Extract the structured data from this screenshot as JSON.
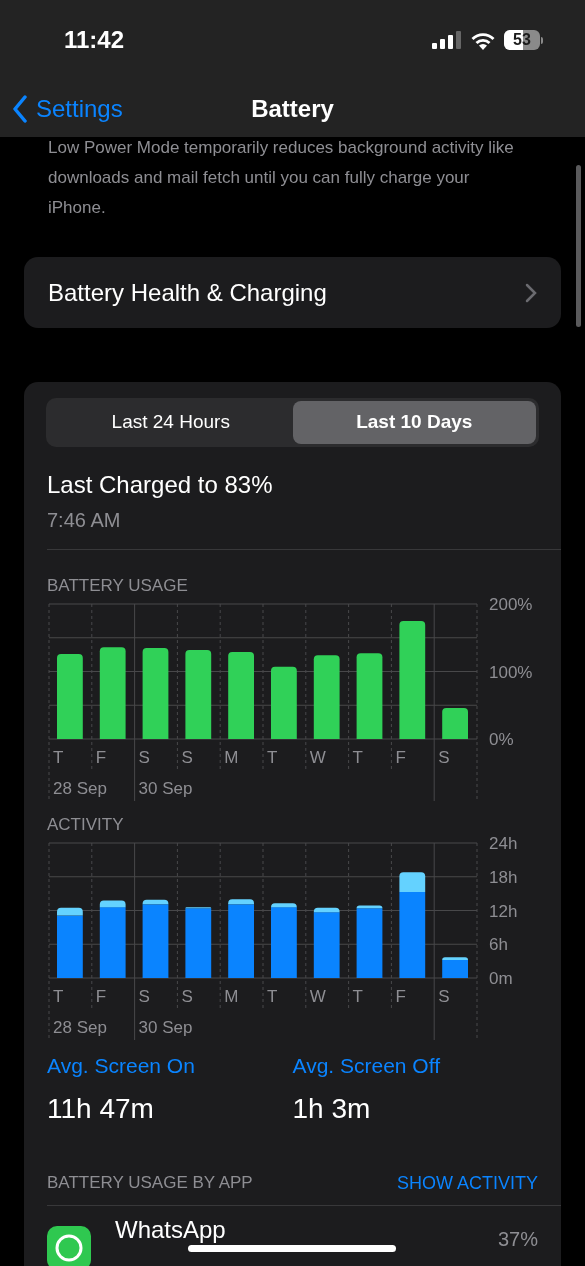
{
  "status_bar": {
    "time": "11:42",
    "battery": "53"
  },
  "nav": {
    "back": "Settings",
    "title": "Battery"
  },
  "low_power_note": "Low Power Mode temporarily reduces background activity like downloads and mail fetch until you can fully charge your iPhone.",
  "health_row": {
    "label": "Battery Health & Charging"
  },
  "segments": [
    {
      "label": "Last 24 Hours",
      "selected": false
    },
    {
      "label": "Last 10 Days",
      "selected": true
    }
  ],
  "last_charged": {
    "title": "Last Charged to 83%",
    "time": "7:46 AM"
  },
  "usage_chart": {
    "title": "BATTERY USAGE",
    "dates": [
      "28 Sep",
      "30 Sep"
    ],
    "chart_data": {
      "type": "bar",
      "grid": true,
      "categories": [
        "T",
        "F",
        "S",
        "S",
        "M",
        "T",
        "W",
        "T",
        "F",
        "S"
      ],
      "ylim": [
        0,
        200
      ],
      "yticks": [
        {
          "value": 0,
          "label": "0%"
        },
        {
          "value": 100,
          "label": "100%"
        },
        {
          "value": 200,
          "label": "200%"
        }
      ],
      "series": [
        {
          "color": "#30d158",
          "values": [
            126,
            136,
            135,
            132,
            129,
            107,
            124,
            127,
            175,
            46
          ]
        }
      ]
    }
  },
  "activity_chart": {
    "title": "ACTIVITY",
    "dates": [
      "28 Sep",
      "30 Sep"
    ],
    "chart_data": {
      "type": "bar",
      "grid": true,
      "stacked": true,
      "categories": [
        "T",
        "F",
        "S",
        "S",
        "M",
        "T",
        "W",
        "T",
        "F",
        "S"
      ],
      "ylim": [
        0,
        24
      ],
      "yticks": [
        {
          "value": 0,
          "label": "0m"
        },
        {
          "value": 6,
          "label": "6h"
        },
        {
          "value": 12,
          "label": "12h"
        },
        {
          "value": 18,
          "label": "18h"
        },
        {
          "value": 24,
          "label": "24h"
        }
      ],
      "series": [
        {
          "color": "#0a84ff",
          "values": [
            11.1,
            12.6,
            13.1,
            12.4,
            13.1,
            12.6,
            11.7,
            12.4,
            15.3,
            3.2
          ]
        },
        {
          "color": "#64d2ff",
          "values": [
            1.4,
            1.2,
            0.8,
            0.2,
            0.9,
            0.7,
            0.8,
            0.5,
            3.5,
            0.5
          ]
        }
      ]
    }
  },
  "averages": [
    {
      "label": "Avg. Screen On",
      "value": "11h 47m"
    },
    {
      "label": "Avg. Screen Off",
      "value": "1h 3m"
    }
  ],
  "by_app": {
    "title": "BATTERY USAGE BY APP",
    "action": "SHOW ACTIVITY",
    "apps": [
      {
        "name": "WhatsApp",
        "percent": "37%"
      }
    ]
  }
}
